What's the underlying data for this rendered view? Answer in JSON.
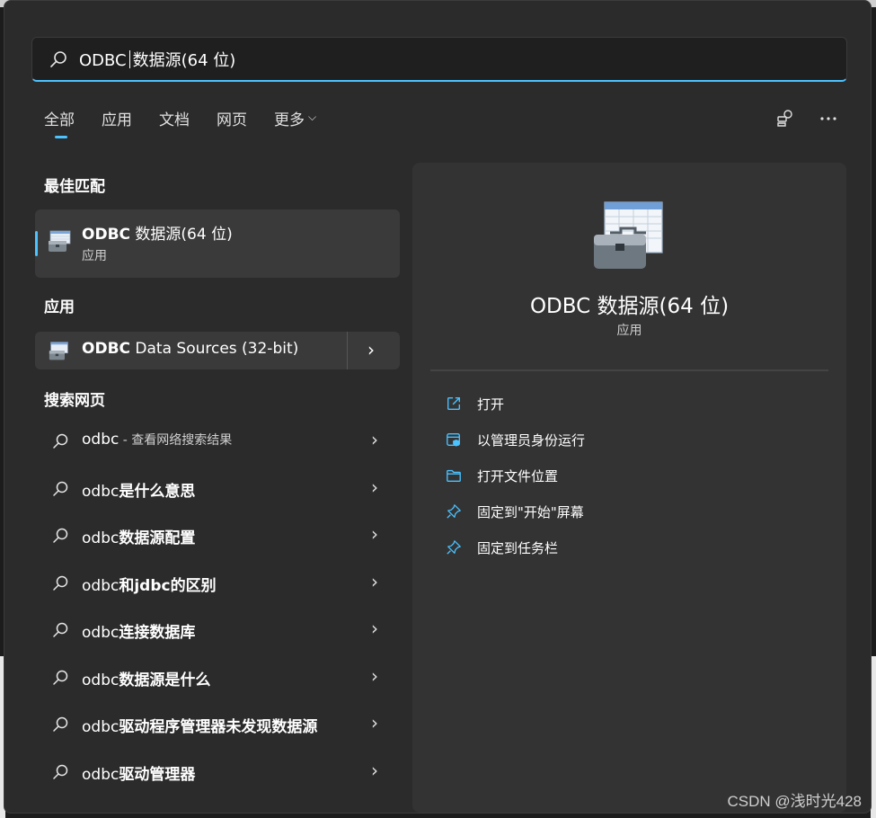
{
  "search": {
    "query_prefix": "ODBC",
    "query_suffix": "数据源(64 位)"
  },
  "tabs": [
    {
      "label": "全部",
      "active": true
    },
    {
      "label": "应用",
      "active": false
    },
    {
      "label": "文档",
      "active": false
    },
    {
      "label": "网页",
      "active": false
    },
    {
      "label": "更多",
      "active": false
    }
  ],
  "top_icons": [
    "account-share-icon",
    "more-options-icon"
  ],
  "sections": {
    "best_match": "最佳匹配",
    "apps": "应用",
    "web": "搜索网页"
  },
  "best_match": {
    "name_bold": "ODBC",
    "name_rest": " 数据源(64 位)",
    "type": "应用"
  },
  "apps": [
    {
      "name_bold": "ODBC",
      "name_rest": " Data Sources (32-bit)"
    }
  ],
  "web_results": [
    {
      "prefix": "odbc",
      "suffix": " - 查看网络搜索结果",
      "suffix_style": "sub"
    },
    {
      "prefix": "odbc",
      "suffix": "是什么意思",
      "suffix_style": "bold"
    },
    {
      "prefix": "odbc",
      "suffix": "数据源配置",
      "suffix_style": "bold"
    },
    {
      "prefix": "odbc",
      "suffix": "和jdbc的区别",
      "suffix_style": "bold"
    },
    {
      "prefix": "odbc",
      "suffix": "连接数据库",
      "suffix_style": "bold"
    },
    {
      "prefix": "odbc",
      "suffix": "数据源是什么",
      "suffix_style": "bold"
    },
    {
      "prefix": "odbc",
      "suffix": "驱动程序管理器未发现数据源",
      "suffix_style": "bold"
    },
    {
      "prefix": "odbc",
      "suffix": "驱动管理器",
      "suffix_style": "bold"
    }
  ],
  "detail": {
    "title": "ODBC 数据源(64 位)",
    "subtitle": "应用",
    "actions": [
      {
        "label": "打开",
        "icon": "open-external-icon"
      },
      {
        "label": "以管理员身份运行",
        "icon": "shield-admin-icon"
      },
      {
        "label": "打开文件位置",
        "icon": "folder-icon"
      },
      {
        "label": "固定到\"开始\"屏幕",
        "icon": "pin-icon"
      },
      {
        "label": "固定到任务栏",
        "icon": "pin-icon"
      }
    ]
  },
  "watermark": "CSDN @浅时光428",
  "colors": {
    "accent": "#4cc2ff",
    "panel": "#2b2b2b",
    "detail": "#333333"
  }
}
